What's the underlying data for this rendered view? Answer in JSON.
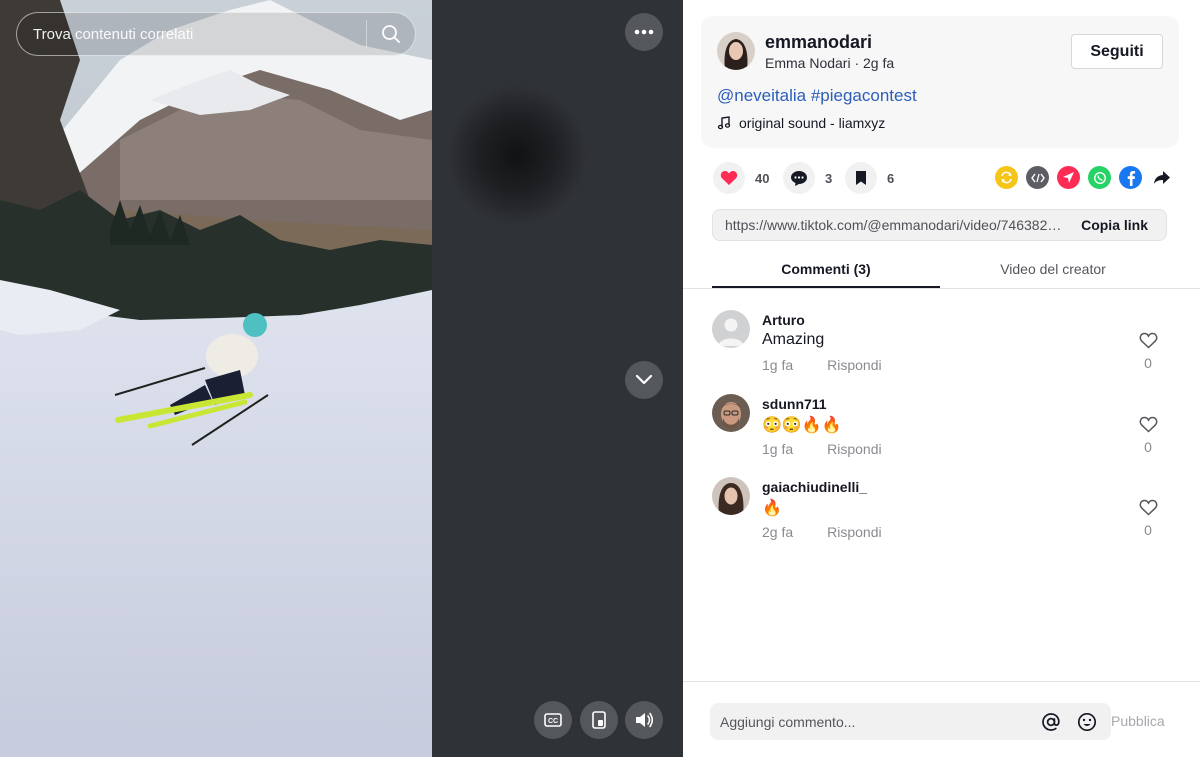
{
  "search": {
    "placeholder": "Trova contenuti correlati"
  },
  "author": {
    "username": "emmanodari",
    "display_name": "Emma Nodari",
    "time_ago": "2g fa",
    "meta": "Emma Nodari · 2g fa",
    "follow_label": "Seguiti"
  },
  "caption": {
    "hashtags": [
      "@neveitalia",
      "#piegacontest"
    ],
    "sound": "original sound - liamxyz"
  },
  "actions": {
    "likes": "40",
    "comments": "3",
    "saves": "6",
    "like_color": "#fe2c55"
  },
  "share": {
    "icons": [
      "repost-icon",
      "embed-icon",
      "send-icon",
      "whatsapp-icon",
      "facebook-icon",
      "share-arrow-icon"
    ],
    "colors": {
      "repost": "#f5c518",
      "embed": "#5c5e63",
      "send": "#fe2c55",
      "whatsapp": "#25d366",
      "facebook": "#1877f2"
    }
  },
  "link": {
    "url": "https://www.tiktok.com/@emmanodari/video/7463828...",
    "copy_label": "Copia link"
  },
  "tabs": [
    {
      "label": "Commenti (3)",
      "active": true
    },
    {
      "label": "Video del creator",
      "active": false
    }
  ],
  "comments": [
    {
      "user": "Arturo",
      "text": "Amazing",
      "time": "1g fa",
      "reply_label": "Rispondi",
      "likes": "0"
    },
    {
      "user": "sdunn711",
      "text": "😳😳🔥🔥",
      "time": "1g fa",
      "reply_label": "Rispondi",
      "likes": "0"
    },
    {
      "user": "gaiachiudinelli_",
      "text": "🔥",
      "time": "2g fa",
      "reply_label": "Rispondi",
      "likes": "0"
    }
  ],
  "comment_box": {
    "placeholder": "Aggiungi commento...",
    "publish_label": "Pubblica"
  }
}
